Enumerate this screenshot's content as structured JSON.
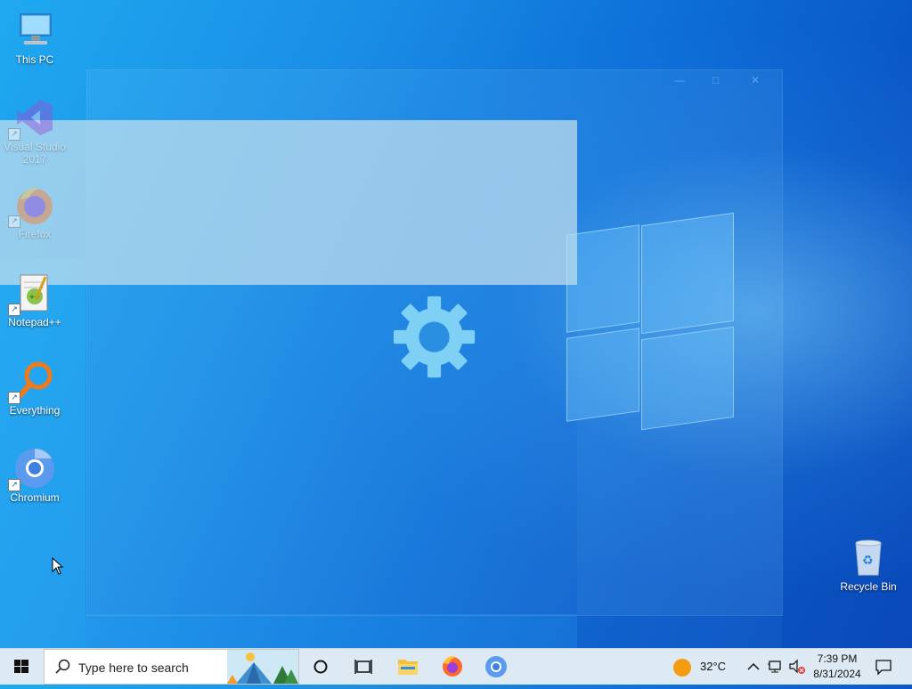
{
  "desktop": {
    "icons": [
      {
        "name": "this-pc",
        "label": "This PC"
      },
      {
        "name": "visual-studio",
        "label": "Visual Studio 2017"
      },
      {
        "name": "firefox",
        "label": "Firefox"
      },
      {
        "name": "notepadpp",
        "label": "Notepad++"
      },
      {
        "name": "everything",
        "label": "Everything"
      },
      {
        "name": "chromium",
        "label": "Chromium"
      },
      {
        "name": "recycle-bin",
        "label": "Recycle Bin"
      }
    ]
  },
  "taskbar": {
    "search_placeholder": "Type here to search",
    "weather": "32°C",
    "time": "7:39 PM",
    "date": "8/31/2024",
    "pinned": [
      {
        "name": "cortana-icon"
      },
      {
        "name": "task-view-icon"
      },
      {
        "name": "file-explorer-icon"
      },
      {
        "name": "firefox-icon"
      },
      {
        "name": "chromium-icon"
      }
    ]
  },
  "colors": {
    "taskbar_bg": "#ddeaf4",
    "desktop_blue": "#0d6fd8",
    "gear": "#7fd0f5"
  }
}
